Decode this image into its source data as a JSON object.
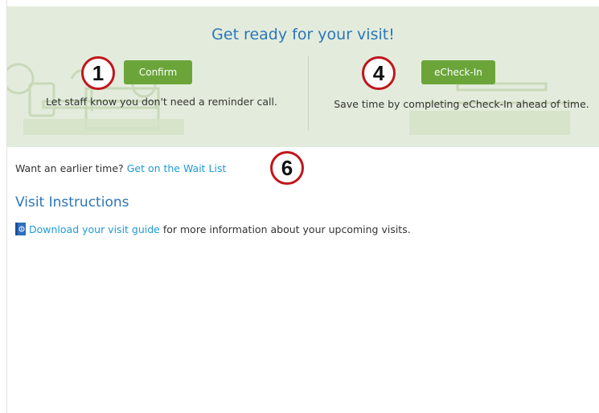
{
  "banner": {
    "title": "Get ready for your visit!",
    "confirm": {
      "marker": "1",
      "button_label": "Confirm",
      "description": "Let staff know you don't need a reminder call."
    },
    "echeckin": {
      "marker": "4",
      "button_label": "eCheck-In",
      "description": "Save time by completing eCheck-In ahead of time."
    }
  },
  "waitlist": {
    "prompt": "Want an earlier time?",
    "link_label": "Get on the Wait List",
    "marker": "6"
  },
  "visit_instructions": {
    "title": "Visit Instructions",
    "link_label": "Download your visit guide",
    "trailing_text": " for more information about your upcoming visits.",
    "icon": "document-icon"
  },
  "colors": {
    "banner_bg": "#e3ecdc",
    "title_blue": "#2b76b9",
    "link_blue": "#1f9ad6",
    "button_green": "#6ba53a",
    "marker_red": "#c0161c"
  }
}
